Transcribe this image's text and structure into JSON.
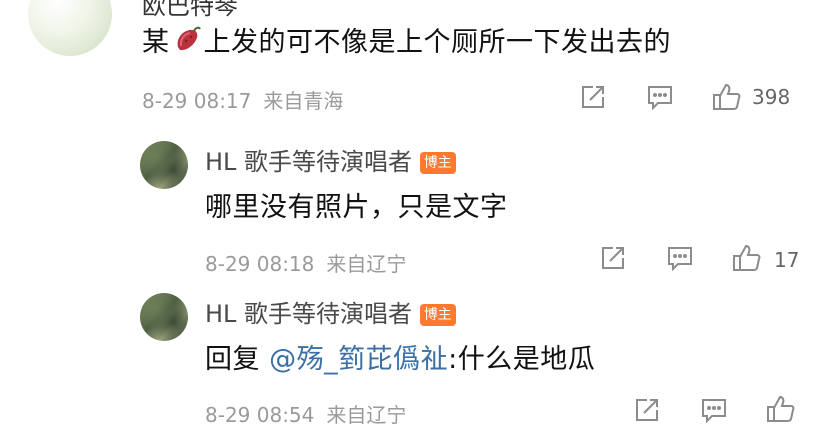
{
  "comment": {
    "user_name": "欧巴特琴",
    "text_before": "某",
    "text_emoji": "sweet-potato",
    "text_after": "上发的可不像是上个厕所一下发出去的",
    "date": "8-29 08:17",
    "location": "来自青海",
    "like_count": "398"
  },
  "replies": [
    {
      "user_name": "HL 歌手等待演唱者",
      "badge": "博主",
      "text": "哪里没有照片，只是文字",
      "date": "8-29 08:18",
      "location": "来自辽宁",
      "like_count": "17"
    },
    {
      "user_name": "HL 歌手等待演唱者",
      "badge": "博主",
      "reply_prefix": "回复 ",
      "mention": "@殇_箌芘僞祉",
      "text": ":什么是地瓜",
      "date": "8-29 08:54",
      "location": "来自辽宁",
      "like_count": ""
    }
  ],
  "colors": {
    "badge": "#ff7a2f",
    "mention": "#3a6fa8",
    "meta": "#9a9a9a",
    "icon": "#8c8c8c"
  }
}
